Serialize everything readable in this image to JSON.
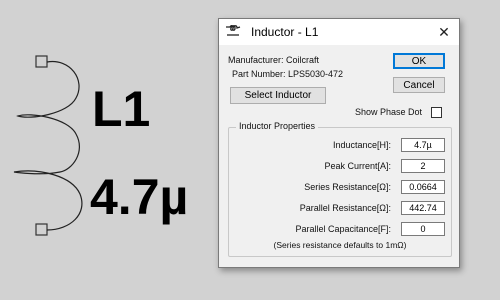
{
  "schematic": {
    "reference": "L1",
    "value": "4.7µ"
  },
  "dialog": {
    "title": "Inductor - L1",
    "close_glyph": "✕",
    "manufacturer": "Manufacturer: Coilcraft",
    "part_number": "Part Number: LPS5030-472",
    "ok_label": "OK",
    "cancel_label": "Cancel",
    "select_label": "Select Inductor",
    "show_phase_dot_label": "Show Phase Dot",
    "show_phase_dot_checked": false,
    "group_title": "Inductor Properties",
    "fields": {
      "inductance": {
        "label": "Inductance[H]:",
        "value": "4.7µ"
      },
      "peak_current": {
        "label": "Peak Current[A]:",
        "value": "2"
      },
      "series_resistance": {
        "label": "Series Resistance[Ω]:",
        "value": "0.0664"
      },
      "parallel_resistance": {
        "label": "Parallel Resistance[Ω]:",
        "value": "442.74"
      },
      "parallel_capacitance": {
        "label": "Parallel Capacitance[F]:",
        "value": "0"
      }
    },
    "note": "(Series resistance defaults to 1mΩ)"
  },
  "colors": {
    "background": "#d2d2d2",
    "dialog": "#f0f0f0",
    "accent": "#0078d7"
  }
}
